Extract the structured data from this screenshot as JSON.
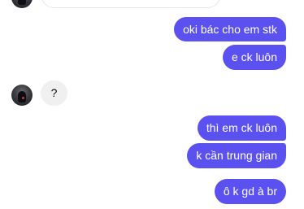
{
  "chat": {
    "messages": [
      {
        "sender": "me",
        "text": "oki bác cho em stk"
      },
      {
        "sender": "me",
        "text": "e ck luôn"
      },
      {
        "sender": "other",
        "text": "?"
      },
      {
        "sender": "me",
        "text": "thì em ck luôn"
      },
      {
        "sender": "me",
        "text": "k cần trung gian"
      },
      {
        "sender": "me",
        "text": "ô k gd à br"
      }
    ]
  },
  "colors": {
    "outgoing_bubble": "#5b51f0",
    "incoming_bubble": "#f0f0f0"
  }
}
